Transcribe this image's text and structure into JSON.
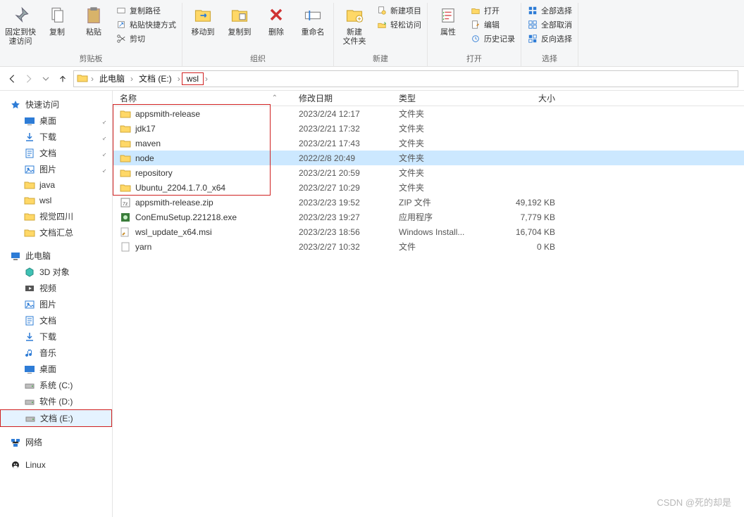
{
  "ribbon": {
    "groups": [
      {
        "label": "剪贴板",
        "large": [
          {
            "name": "pin-to-quick-access",
            "icon": "pin",
            "label": "固定到快\n速访问"
          },
          {
            "name": "copy",
            "icon": "copy",
            "label": "复制"
          },
          {
            "name": "paste",
            "icon": "paste",
            "label": "粘贴"
          }
        ],
        "small": [
          {
            "name": "copy-path",
            "icon": "path",
            "label": "复制路径"
          },
          {
            "name": "paste-shortcut",
            "icon": "shortcut",
            "label": "粘贴快捷方式"
          },
          {
            "name": "cut",
            "icon": "scissors",
            "label": "剪切"
          }
        ]
      },
      {
        "label": "组织",
        "large": [
          {
            "name": "move-to",
            "icon": "moveto",
            "label": "移动到"
          },
          {
            "name": "copy-to",
            "icon": "copyto",
            "label": "复制到"
          },
          {
            "name": "delete",
            "icon": "delete",
            "label": "删除"
          },
          {
            "name": "rename",
            "icon": "rename",
            "label": "重命名"
          }
        ]
      },
      {
        "label": "新建",
        "large": [
          {
            "name": "new-folder",
            "icon": "newfolder",
            "label": "新建\n文件夹"
          }
        ],
        "small": [
          {
            "name": "new-item",
            "icon": "newitem",
            "label": "新建项目"
          },
          {
            "name": "easy-access",
            "icon": "easyaccess",
            "label": "轻松访问"
          }
        ]
      },
      {
        "label": "打开",
        "large": [
          {
            "name": "properties",
            "icon": "properties",
            "label": "属性"
          }
        ],
        "small": [
          {
            "name": "open",
            "icon": "open",
            "label": "打开"
          },
          {
            "name": "edit",
            "icon": "edit",
            "label": "编辑"
          },
          {
            "name": "history",
            "icon": "history",
            "label": "历史记录"
          }
        ]
      },
      {
        "label": "选择",
        "small": [
          {
            "name": "select-all",
            "icon": "selectall",
            "label": "全部选择"
          },
          {
            "name": "select-none",
            "icon": "selectnone",
            "label": "全部取消"
          },
          {
            "name": "invert-selection",
            "icon": "invert",
            "label": "反向选择"
          }
        ]
      }
    ]
  },
  "breadcrumb": [
    "此电脑",
    "文档 (E:)",
    "wsl"
  ],
  "sidebar": {
    "quick_access_label": "快速访问",
    "quick": [
      {
        "name": "desktop",
        "icon": "desktop",
        "label": "桌面",
        "pinned": true
      },
      {
        "name": "downloads",
        "icon": "downloads",
        "label": "下载",
        "pinned": true
      },
      {
        "name": "documents",
        "icon": "documents",
        "label": "文档",
        "pinned": true
      },
      {
        "name": "pictures",
        "icon": "pictures",
        "label": "图片",
        "pinned": true
      },
      {
        "name": "java",
        "icon": "folder",
        "label": "java"
      },
      {
        "name": "wsl",
        "icon": "folder",
        "label": "wsl"
      },
      {
        "name": "shijue",
        "icon": "folder",
        "label": "视觉四川"
      },
      {
        "name": "wendang",
        "icon": "folder",
        "label": "文档汇总"
      }
    ],
    "thispc_label": "此电脑",
    "thispc": [
      {
        "name": "3d-objects",
        "icon": "objects3d",
        "label": "3D 对象"
      },
      {
        "name": "videos",
        "icon": "videos",
        "label": "视频"
      },
      {
        "name": "pictures2",
        "icon": "pictures",
        "label": "图片"
      },
      {
        "name": "documents2",
        "icon": "documents",
        "label": "文档"
      },
      {
        "name": "downloads2",
        "icon": "downloads",
        "label": "下载"
      },
      {
        "name": "music",
        "icon": "music",
        "label": "音乐"
      },
      {
        "name": "desktop2",
        "icon": "desktop",
        "label": "桌面"
      },
      {
        "name": "drive-c",
        "icon": "drive",
        "label": "系统 (C:)"
      },
      {
        "name": "drive-d",
        "icon": "drive",
        "label": "软件 (D:)"
      },
      {
        "name": "drive-e",
        "icon": "drive",
        "label": "文档 (E:)",
        "selected": true,
        "redbox": true
      }
    ],
    "network_label": "网络",
    "network_icon": "network",
    "linux_label": "Linux",
    "linux_icon": "linux"
  },
  "columns": {
    "name": "名称",
    "date": "修改日期",
    "type": "类型",
    "size": "大小"
  },
  "files": [
    {
      "icon": "folder",
      "name": "appsmith-release",
      "date": "2023/2/24 12:17",
      "type": "文件夹",
      "size": "",
      "redbox": true
    },
    {
      "icon": "folder",
      "name": "jdk17",
      "date": "2023/2/21 17:32",
      "type": "文件夹",
      "size": "",
      "redbox": true
    },
    {
      "icon": "folder",
      "name": "maven",
      "date": "2023/2/21 17:43",
      "type": "文件夹",
      "size": "",
      "redbox": true
    },
    {
      "icon": "folder",
      "name": "node",
      "date": "2022/2/8 20:49",
      "type": "文件夹",
      "size": "",
      "selected": true,
      "redbox": true
    },
    {
      "icon": "folder",
      "name": "repository",
      "date": "2023/2/21 20:59",
      "type": "文件夹",
      "size": "",
      "redbox": true
    },
    {
      "icon": "folder",
      "name": "Ubuntu_2204.1.7.0_x64",
      "date": "2023/2/27 10:29",
      "type": "文件夹",
      "size": "",
      "redbox": true
    },
    {
      "icon": "zip",
      "name": "appsmith-release.zip",
      "date": "2023/2/23 19:52",
      "type": "ZIP 文件",
      "size": "49,192 KB"
    },
    {
      "icon": "exe",
      "name": "ConEmuSetup.221218.exe",
      "date": "2023/2/23 19:27",
      "type": "应用程序",
      "size": "7,779 KB"
    },
    {
      "icon": "msi",
      "name": "wsl_update_x64.msi",
      "date": "2023/2/23 18:56",
      "type": "Windows Install...",
      "size": "16,704 KB"
    },
    {
      "icon": "file",
      "name": "yarn",
      "date": "2023/2/27 10:32",
      "type": "文件",
      "size": "0 KB"
    }
  ],
  "watermark": "CSDN @死的却是"
}
